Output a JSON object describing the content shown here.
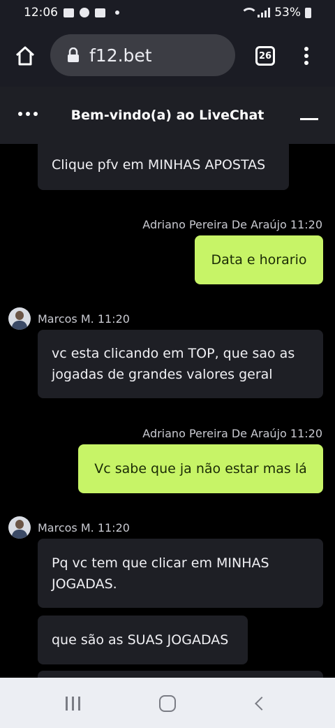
{
  "status_bar": {
    "time": "12:06",
    "battery": "53%"
  },
  "browser": {
    "url": "f12.bet",
    "tab_count": "26"
  },
  "livechat": {
    "title": "Bem-vindo(a) ao LiveChat"
  },
  "messages": [
    {
      "type": "incoming",
      "text": "Clique pfv em MINHAS APOSTAS"
    },
    {
      "type": "meta",
      "text": "Adriano Pereira De Araújo 11:20"
    },
    {
      "type": "outgoing",
      "text": "Data e horario"
    },
    {
      "type": "meta",
      "text": "Marcos M. 11:20"
    },
    {
      "type": "incoming",
      "lines": [
        "vc esta clicando em TOP, que sao as",
        "jogadas de grandes valores geral"
      ]
    },
    {
      "type": "meta",
      "text": "Adriano Pereira De Araújo 11:20"
    },
    {
      "type": "outgoing",
      "text": "Vc sabe que ja não estar mas lá"
    },
    {
      "type": "meta",
      "text": "Marcos M. 11:20"
    },
    {
      "type": "incoming",
      "lines": [
        "Pq vc tem que clicar em MINHAS",
        "JOGADAS."
      ]
    },
    {
      "type": "incoming",
      "text": "que são as SUAS JOGADAS"
    }
  ],
  "colors": {
    "outgoing_bubble": "#c7f467",
    "incoming_bubble": "#1e1f25",
    "header_bg": "#1e1f25",
    "browser_bg": "#1b1c24"
  },
  "icons": [
    "image-icon",
    "shield-icon",
    "youtube-icon",
    "wifi-icon",
    "signal-icon",
    "battery-icon",
    "home-icon",
    "lock-icon",
    "tabs-icon",
    "menu-icon",
    "more-icon",
    "minimize-icon",
    "avatar",
    "recent-apps-icon",
    "home-nav-icon",
    "back-icon"
  ]
}
